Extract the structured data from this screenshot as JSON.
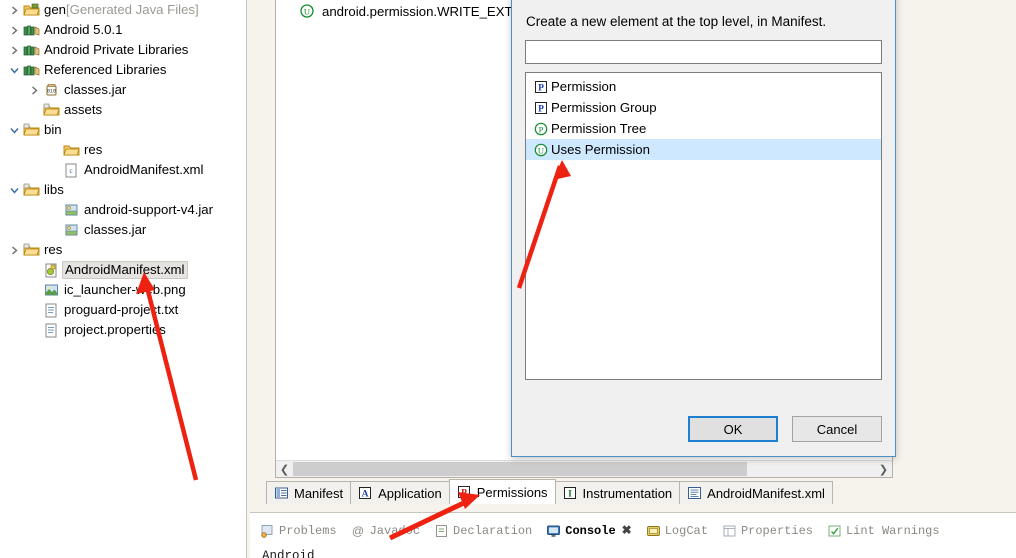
{
  "explorer": {
    "name": "package-explorer",
    "items": [
      {
        "label": "gen",
        "suffix": " [Generated Java Files]",
        "icon": "folder-gen-icon",
        "twisty": "collapsed",
        "indent": 0,
        "selected": false
      },
      {
        "label": "Android 5.0.1",
        "suffix": "",
        "icon": "library-icon",
        "twisty": "collapsed",
        "indent": 0,
        "selected": false
      },
      {
        "label": "Android Private Libraries",
        "suffix": "",
        "icon": "library-icon",
        "twisty": "collapsed",
        "indent": 0,
        "selected": false
      },
      {
        "label": "Referenced Libraries",
        "suffix": "",
        "icon": "library-icon",
        "twisty": "expanded",
        "indent": 0,
        "selected": false
      },
      {
        "label": "classes.jar",
        "suffix": "",
        "icon": "jar-icon",
        "twisty": "collapsed",
        "indent": 1,
        "selected": false
      },
      {
        "label": "assets",
        "suffix": "",
        "icon": "source-folder-icon",
        "twisty": "none",
        "indent": 1,
        "selected": false
      },
      {
        "label": "bin",
        "suffix": "",
        "icon": "source-folder-icon",
        "twisty": "expanded",
        "indent": 0,
        "selected": false
      },
      {
        "label": "res",
        "suffix": "",
        "icon": "folder-icon",
        "twisty": "none",
        "indent": 2,
        "selected": false
      },
      {
        "label": "AndroidManifest.xml",
        "suffix": "",
        "icon": "xml-file-icon",
        "twisty": "none",
        "indent": 2,
        "selected": false
      },
      {
        "label": "libs",
        "suffix": "",
        "icon": "source-folder-icon",
        "twisty": "expanded",
        "indent": 0,
        "selected": false
      },
      {
        "label": "android-support-v4.jar",
        "suffix": "",
        "icon": "jar-lib-icon",
        "twisty": "none",
        "indent": 2,
        "selected": false
      },
      {
        "label": "classes.jar",
        "suffix": "",
        "icon": "jar-lib-icon",
        "twisty": "none",
        "indent": 2,
        "selected": false
      },
      {
        "label": "res",
        "suffix": "",
        "icon": "source-folder-icon",
        "twisty": "collapsed",
        "indent": 0,
        "selected": false
      },
      {
        "label": "AndroidManifest.xml",
        "suffix": "",
        "icon": "android-manifest-icon",
        "twisty": "none",
        "indent": 1,
        "selected": true
      },
      {
        "label": "ic_launcher-web.png",
        "suffix": "",
        "icon": "image-file-icon",
        "twisty": "none",
        "indent": 1,
        "selected": false
      },
      {
        "label": "proguard-project.txt",
        "suffix": "",
        "icon": "text-file-icon",
        "twisty": "none",
        "indent": 1,
        "selected": false
      },
      {
        "label": "project.properties",
        "suffix": "",
        "icon": "text-file-icon",
        "twisty": "none",
        "indent": 1,
        "selected": false
      }
    ]
  },
  "editor": {
    "permission_line": "android.permission.WRITE_EXTER",
    "permission_icon": "uses-permission-icon",
    "scroll_left_icon": "chevron-left-icon",
    "scroll_right_icon": "chevron-right-icon"
  },
  "page_tabs": [
    {
      "label": "Manifest",
      "glyph": "manifest-icon",
      "active": false
    },
    {
      "label": "Application",
      "glyph": "application-icon",
      "active": false
    },
    {
      "label": "Permissions",
      "glyph": "permissions-icon",
      "active": true
    },
    {
      "label": "Instrumentation",
      "glyph": "instrumentation-icon",
      "active": false
    },
    {
      "label": "AndroidManifest.xml",
      "glyph": "xml-source-icon",
      "active": false
    }
  ],
  "view_tabs": [
    {
      "label": "Problems",
      "glyph": "problems-icon",
      "active": false,
      "closable": false
    },
    {
      "label": "Javadoc",
      "glyph": "javadoc-icon",
      "active": false,
      "closable": false
    },
    {
      "label": "Declaration",
      "glyph": "declaration-icon",
      "active": false,
      "closable": false
    },
    {
      "label": "Console",
      "glyph": "console-icon",
      "active": true,
      "closable": true
    },
    {
      "label": "LogCat",
      "glyph": "logcat-icon",
      "active": false,
      "closable": false
    },
    {
      "label": "Properties",
      "glyph": "properties-icon",
      "active": false,
      "closable": false
    },
    {
      "label": "Lint Warnings",
      "glyph": "lint-icon",
      "active": false,
      "closable": false
    }
  ],
  "console": {
    "text": "Android"
  },
  "dialog": {
    "name": "new-element-dialog",
    "prompt": "Create a new element at the top level, in Manifest.",
    "filter_value": "",
    "filter_placeholder": "",
    "items": [
      {
        "label": "Permission",
        "icon": "permission-icon",
        "selected": false
      },
      {
        "label": "Permission Group",
        "icon": "permission-group-icon",
        "selected": false
      },
      {
        "label": "Permission Tree",
        "icon": "permission-tree-icon",
        "selected": false
      },
      {
        "label": "Uses Permission",
        "icon": "uses-permission-icon",
        "selected": true
      }
    ],
    "ok_label": "OK",
    "cancel_label": "Cancel"
  },
  "annotations": [
    {
      "name": "arrow-to-uses-permission",
      "color": "#ee2211"
    },
    {
      "name": "arrow-to-android-manifest",
      "color": "#ee2211"
    },
    {
      "name": "arrow-to-permissions-tab",
      "color": "#ee2211"
    }
  ],
  "colors": {
    "accent": "#1f7fd0",
    "selection": "#cde8ff",
    "annotation": "#ee2211"
  }
}
